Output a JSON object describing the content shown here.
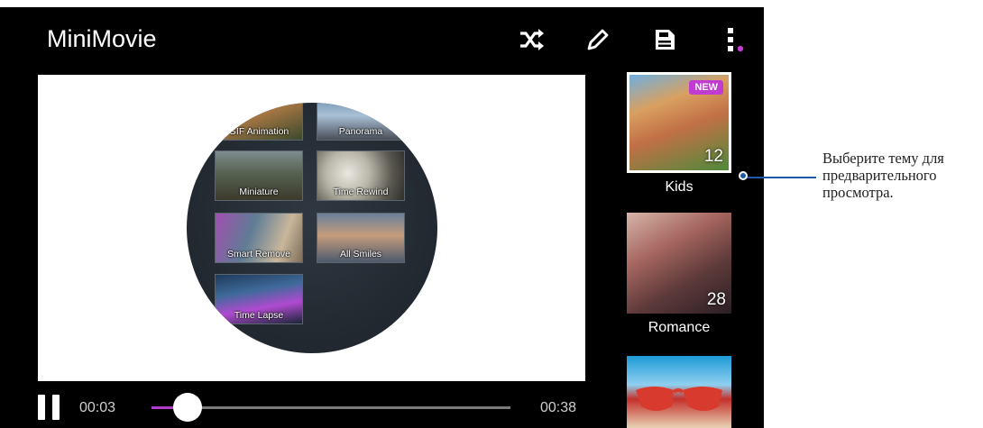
{
  "app": {
    "title": "MiniMovie"
  },
  "toolbar": {
    "icons": [
      "shuffle-icon",
      "pencil-icon",
      "save-icon",
      "overflow-menu-icon"
    ],
    "accent": "#c03cd0"
  },
  "preview": {
    "tiles": [
      {
        "label": "GIF Animation"
      },
      {
        "label": "Panorama"
      },
      {
        "label": "Miniature"
      },
      {
        "label": "Time Rewind"
      },
      {
        "label": "Smart Remove"
      },
      {
        "label": "All Smiles"
      },
      {
        "label": "Time Lapse"
      }
    ]
  },
  "player": {
    "current_time": "00:03",
    "total_time": "00:38",
    "progress": 0.1,
    "state": "playing",
    "accent": "#b03cc8"
  },
  "themes": [
    {
      "name": "Kids",
      "count": "12",
      "badge": "NEW",
      "selected": true
    },
    {
      "name": "Romance",
      "count": "28",
      "selected": false
    },
    {
      "name": "",
      "count": "",
      "selected": false
    }
  ],
  "callout": {
    "text": "Выберите тему для предварительного просмотра.",
    "line_color": "#1c5aa8"
  }
}
